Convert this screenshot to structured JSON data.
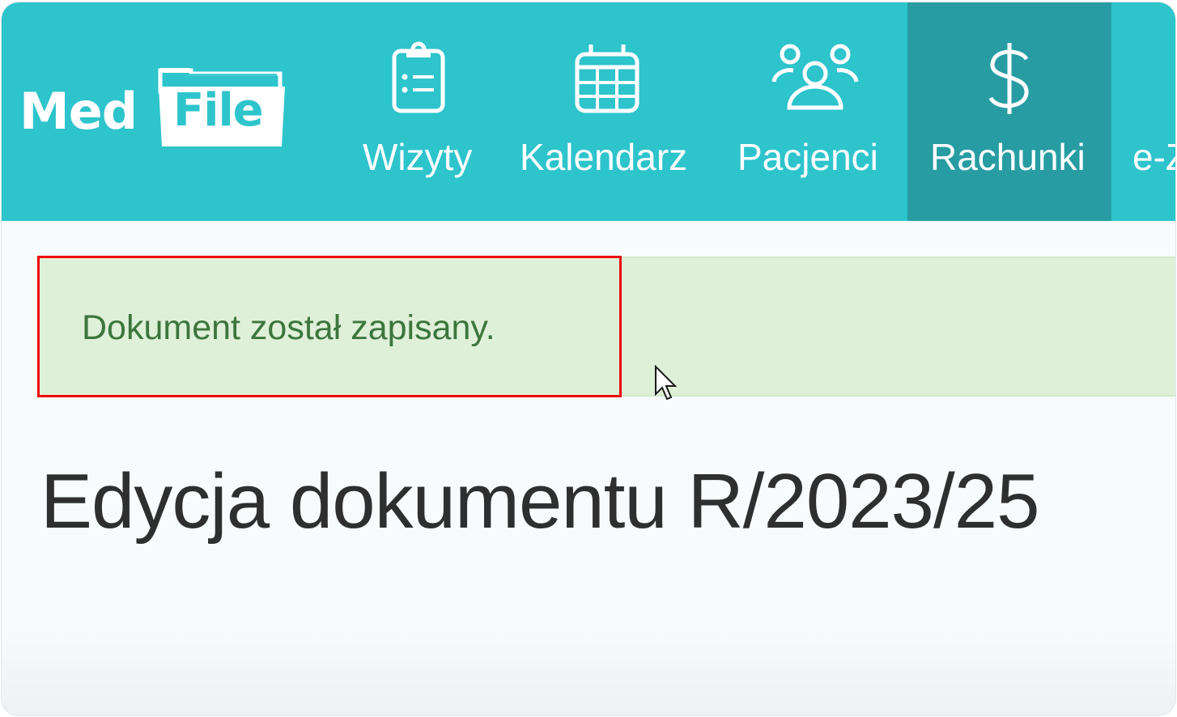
{
  "app": {
    "logo": {
      "part1": "Med",
      "part2": "File"
    }
  },
  "nav": {
    "items": [
      {
        "label": "Wizyty",
        "icon": "clipboard-list-icon",
        "active": false
      },
      {
        "label": "Kalendarz",
        "icon": "calendar-icon",
        "active": false
      },
      {
        "label": "Pacjenci",
        "icon": "users-icon",
        "active": false
      },
      {
        "label": "Rachunki",
        "icon": "dollar-icon",
        "active": true
      },
      {
        "label": "e-Z",
        "icon": "",
        "active": false
      }
    ]
  },
  "alert": {
    "message": "Dokument został zapisany.",
    "type": "success"
  },
  "page": {
    "title": "Edycja dokumentu R/2023/25"
  },
  "colors": {
    "brand": "#2ec4cc",
    "nav_active": "#279da3",
    "success_bg": "#dff0d8",
    "success_text": "#3c763d",
    "highlight": "#ee0c0c"
  }
}
